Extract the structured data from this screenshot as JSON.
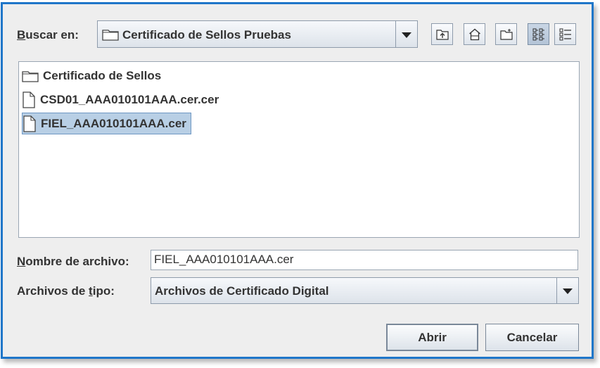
{
  "lookin": {
    "label_pre": "",
    "label_mnemonic": "B",
    "label_post": "uscar en:",
    "current": "Certificado de Sellos Pruebas"
  },
  "toolbar": {
    "icons": [
      "up-folder-icon",
      "home-icon",
      "new-folder-icon",
      "list-view-icon",
      "details-view-icon"
    ],
    "selected_view": "list"
  },
  "files": [
    {
      "name": "Certificado de Sellos",
      "type": "folder",
      "selected": false
    },
    {
      "name": "CSD01_AAA010101AAA.cer.cer",
      "type": "file",
      "selected": false
    },
    {
      "name": "FIEL_AAA010101AAA.cer",
      "type": "file",
      "selected": true
    }
  ],
  "filename": {
    "label_pre": "",
    "label_mnemonic": "N",
    "label_post": "ombre de archivo:",
    "value": "FIEL_AAA010101AAA.cer"
  },
  "filetype": {
    "label_pre": "Archivos de ",
    "label_mnemonic": "t",
    "label_post": "ipo:",
    "value": "Archivos de Certificado Digital"
  },
  "buttons": {
    "open": "Abrir",
    "cancel": "Cancelar"
  }
}
